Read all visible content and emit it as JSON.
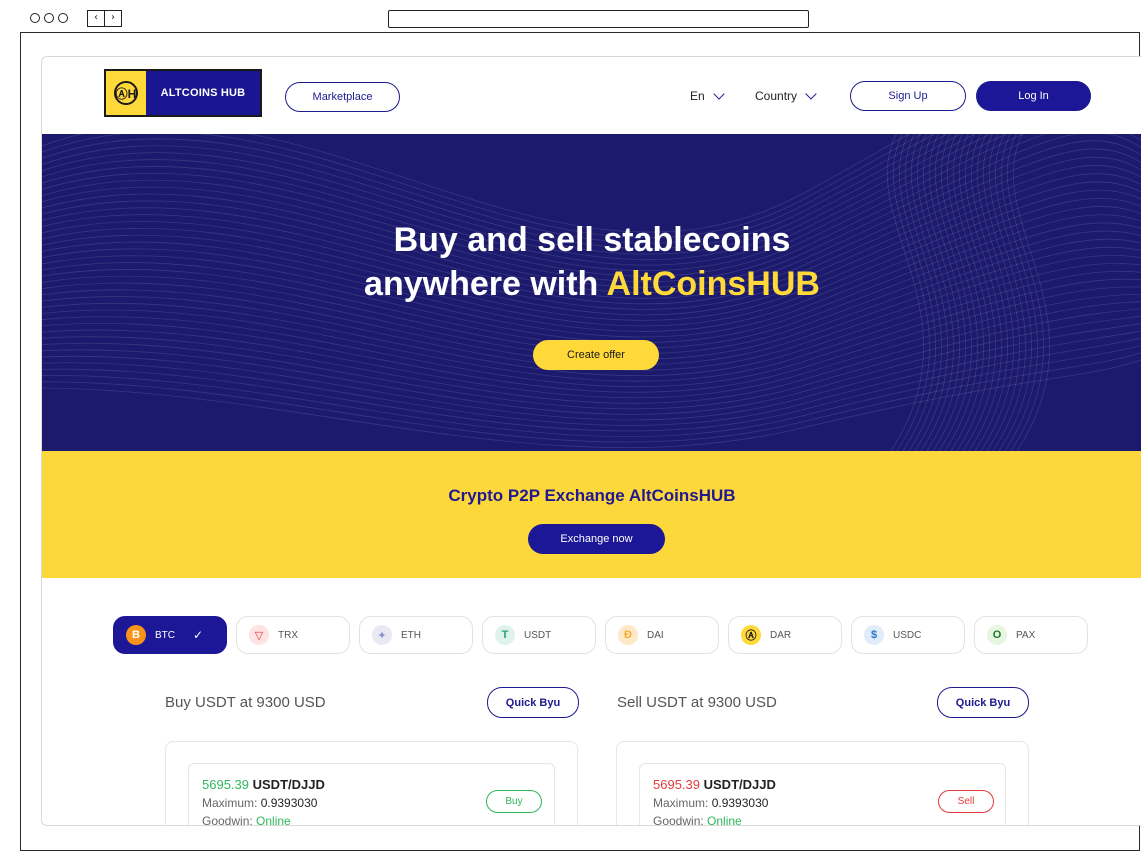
{
  "header": {
    "logo_text": "ALTCOINS HUB",
    "logo_mark": "ⒶH",
    "marketplace": "Marketplace",
    "language": "En",
    "country": "Country",
    "sign_up": "Sign Up",
    "log_in": "Log In"
  },
  "hero": {
    "title_line1": "Buy and sell stablecoins",
    "title_line2_prefix": "anywhere with ",
    "title_line2_accent": "AltCoinsHUB",
    "cta": "Create offer"
  },
  "band": {
    "title": "Crypto P2P Exchange AltCoinsHUB",
    "cta": "Exchange now"
  },
  "coins": [
    {
      "label": "BTC",
      "icon": "bitcoin-icon",
      "glyph": "B",
      "bg": "#f7931a",
      "fg": "#ffffff",
      "active": true
    },
    {
      "label": "TRX",
      "icon": "tron-icon",
      "glyph": "▽",
      "bg": "#fde3e3",
      "fg": "#e5322d"
    },
    {
      "label": "ETH",
      "icon": "ethereum-icon",
      "glyph": "✦",
      "bg": "#e8e9f3",
      "fg": "#8a8fc7"
    },
    {
      "label": "USDT",
      "icon": "tether-icon",
      "glyph": "T",
      "bg": "#dff3ec",
      "fg": "#26a17b"
    },
    {
      "label": "DAI",
      "icon": "dai-icon",
      "glyph": "Đ",
      "bg": "#fde9c7",
      "fg": "#f5ac37"
    },
    {
      "label": "DAR",
      "icon": "altcoinshub-icon",
      "glyph": "Ⓐ",
      "bg": "#ffd93a",
      "fg": "#1a1a1a"
    },
    {
      "label": "USDC",
      "icon": "usdc-icon",
      "glyph": "$",
      "bg": "#e0ecfa",
      "fg": "#2775ca"
    },
    {
      "label": "PAX",
      "icon": "pax-icon",
      "glyph": "O",
      "bg": "#e6f6e0",
      "fg": "#1b7b2b"
    }
  ],
  "buy": {
    "title": "Buy USDT at 9300 USD",
    "quick": "Quick Byu",
    "price": "5695.39",
    "pair": "USDT/DJJD",
    "max_label": "Maximum:",
    "max_value": "0.9393030",
    "goodwin_label": "Goodwin:",
    "status": "Online",
    "action": "Buy"
  },
  "sell": {
    "title": "Sell USDT at 9300 USD",
    "quick": "Quick Byu",
    "price": "5695.39",
    "pair": "USDT/DJJD",
    "max_label": "Maximum:",
    "max_value": "0.9393030",
    "goodwin_label": "Goodwin:",
    "status": "Online",
    "action": "Sell"
  },
  "colors": {
    "brand_navy": "#1b1796",
    "brand_yellow": "#fdd83b",
    "buy_green": "#2eb85c",
    "sell_red": "#e23b3b"
  }
}
